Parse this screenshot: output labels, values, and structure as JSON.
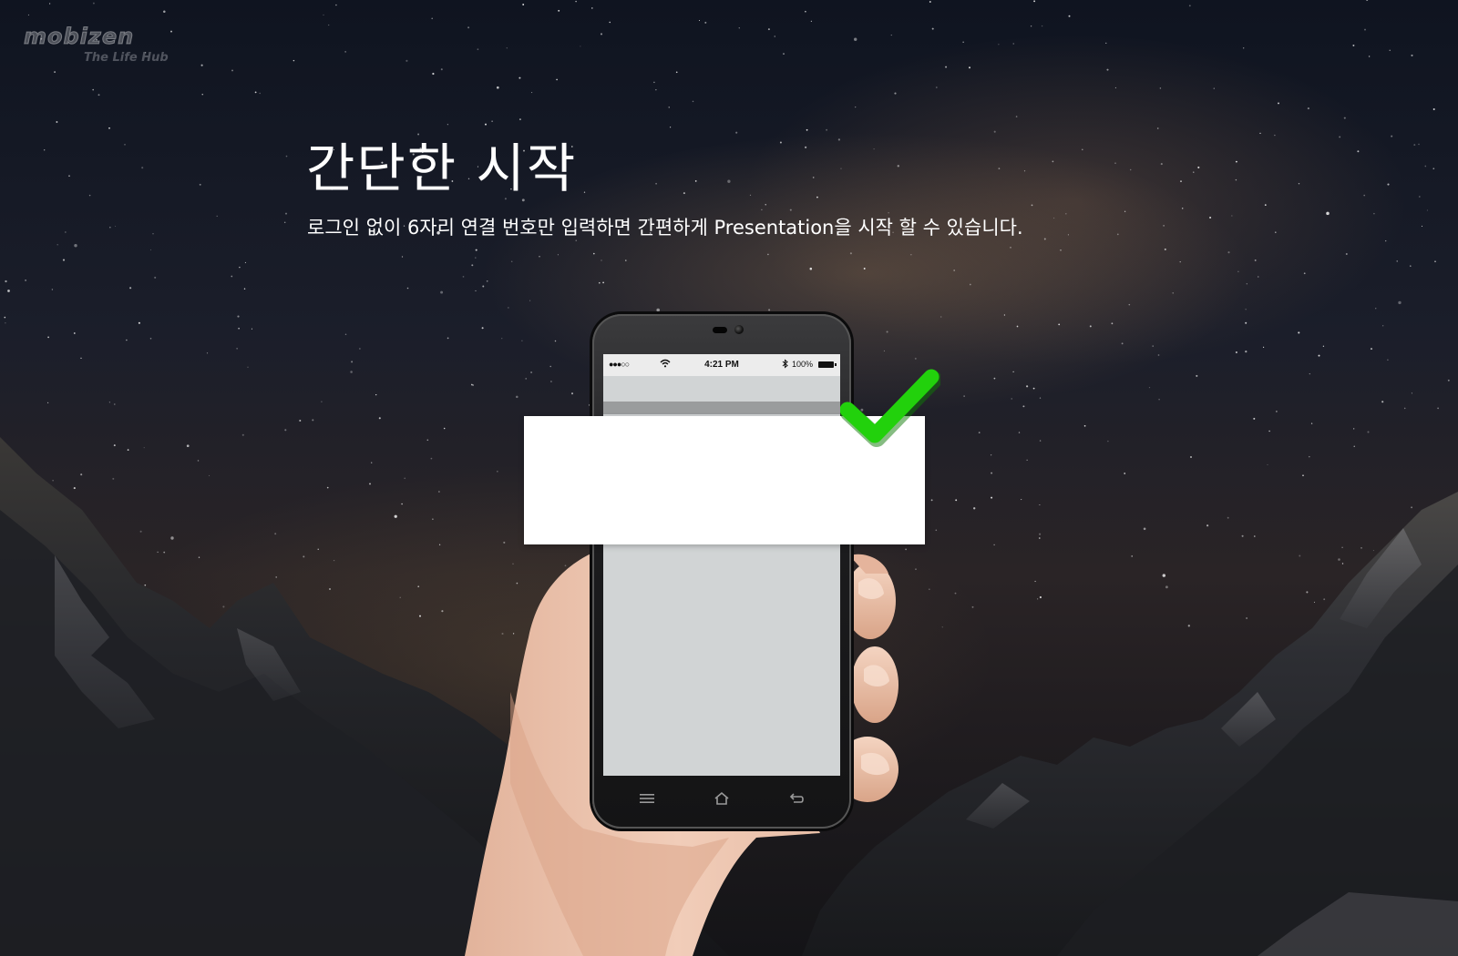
{
  "logo": {
    "word": "mobizen",
    "tagline": "The Life Hub"
  },
  "hero": {
    "title": "간단한 시작",
    "subtitle": "로그인 없이 6자리 연결 번호만 입력하면 간편하게 Presentation을 시작 할 수 있습니다."
  },
  "phone": {
    "status": {
      "signal": "●●●○○",
      "time": "4:21 PM",
      "battery": "100%"
    },
    "icons": {
      "wifi": "wifi-icon",
      "bluetooth": "bluetooth-icon",
      "menu": "menu-icon",
      "home": "home-icon",
      "back": "back-icon"
    }
  },
  "colors": {
    "check": "#22d10c",
    "screen": "#d1d4d5",
    "popup": "#ffffff"
  }
}
